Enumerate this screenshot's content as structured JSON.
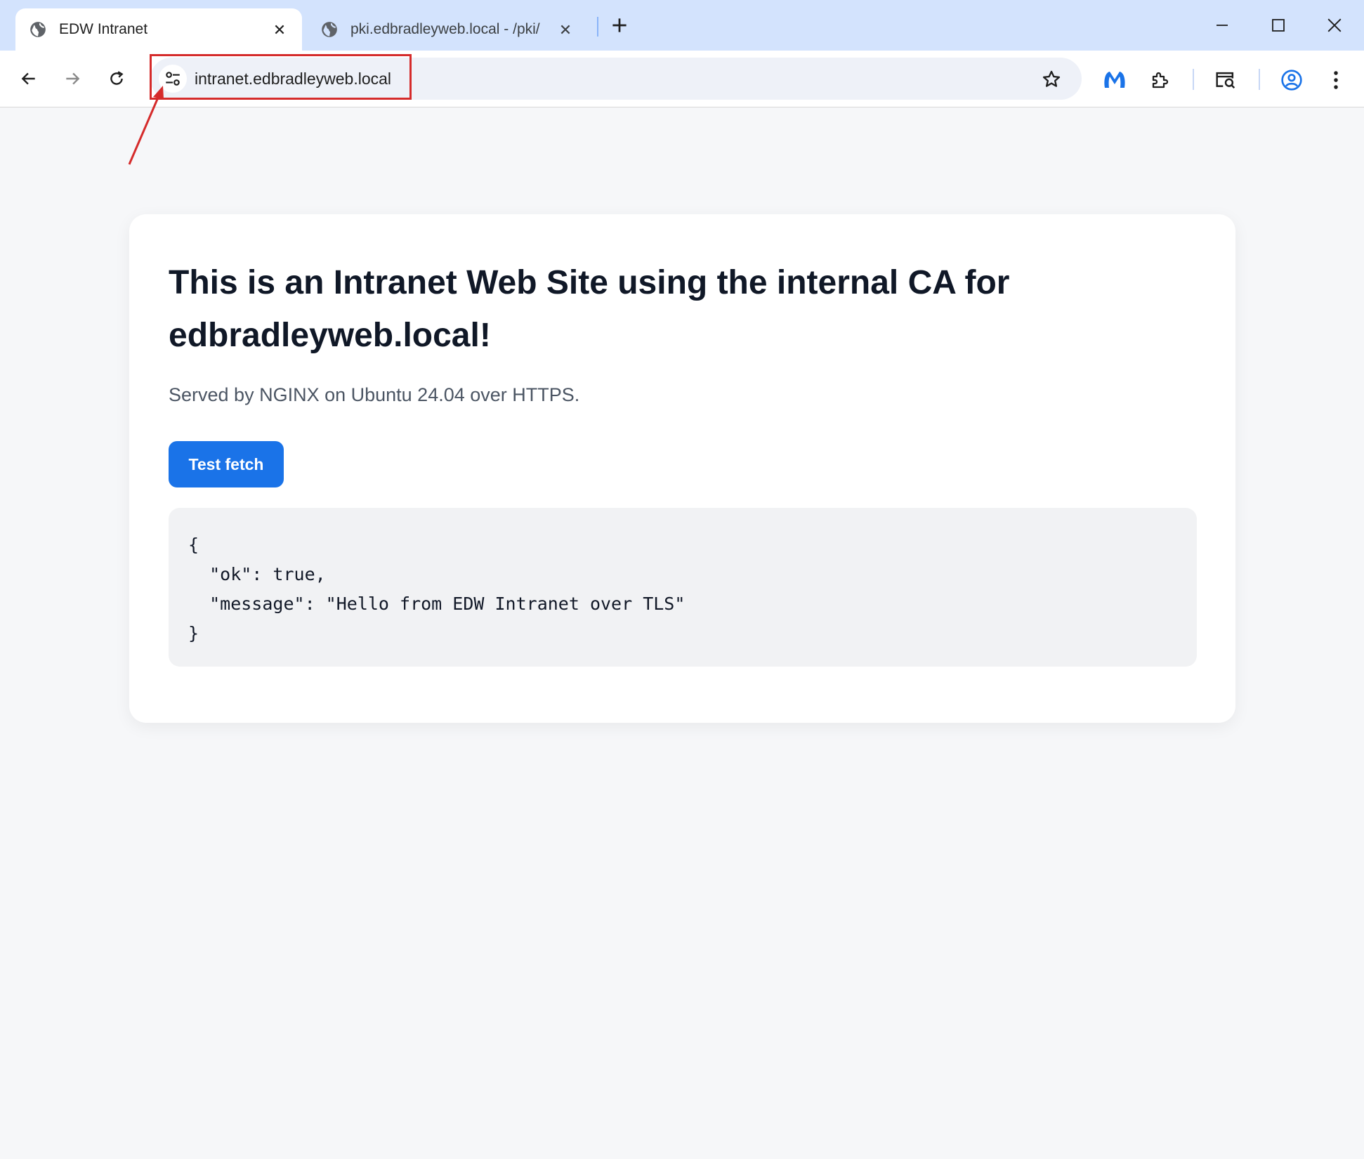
{
  "browser": {
    "tabs": [
      {
        "title": "EDW Intranet",
        "active": true
      },
      {
        "title": "pki.edbradleyweb.local - /pki/",
        "active": false
      }
    ],
    "address_bar": {
      "url": "intranet.edbradleyweb.local"
    },
    "icons": {
      "tab_favicon": "globe-icon",
      "back": "arrow-left-icon",
      "forward": "arrow-right-icon",
      "reload": "reload-icon",
      "site_info": "tune-icon",
      "bookmark": "star-icon",
      "extension_1": "malwarebytes-icon",
      "extensions": "puzzle-icon",
      "reading_mode": "search-tab-icon",
      "profile": "account-circle-icon",
      "menu": "kebab-menu-icon"
    },
    "colors": {
      "tabstrip": "#d3e3fd",
      "accent": "#1a73e8",
      "annotation": "#d52b2b"
    }
  },
  "page": {
    "heading": "This is an Intranet Web Site using the internal CA for edbradleyweb.local!",
    "subtitle": "Served by NGINX on Ubuntu 24.04 over HTTPS.",
    "button_label": "Test fetch",
    "response": "{\n  \"ok\": true,\n  \"message\": \"Hello from EDW Intranet over TLS\"\n}"
  }
}
